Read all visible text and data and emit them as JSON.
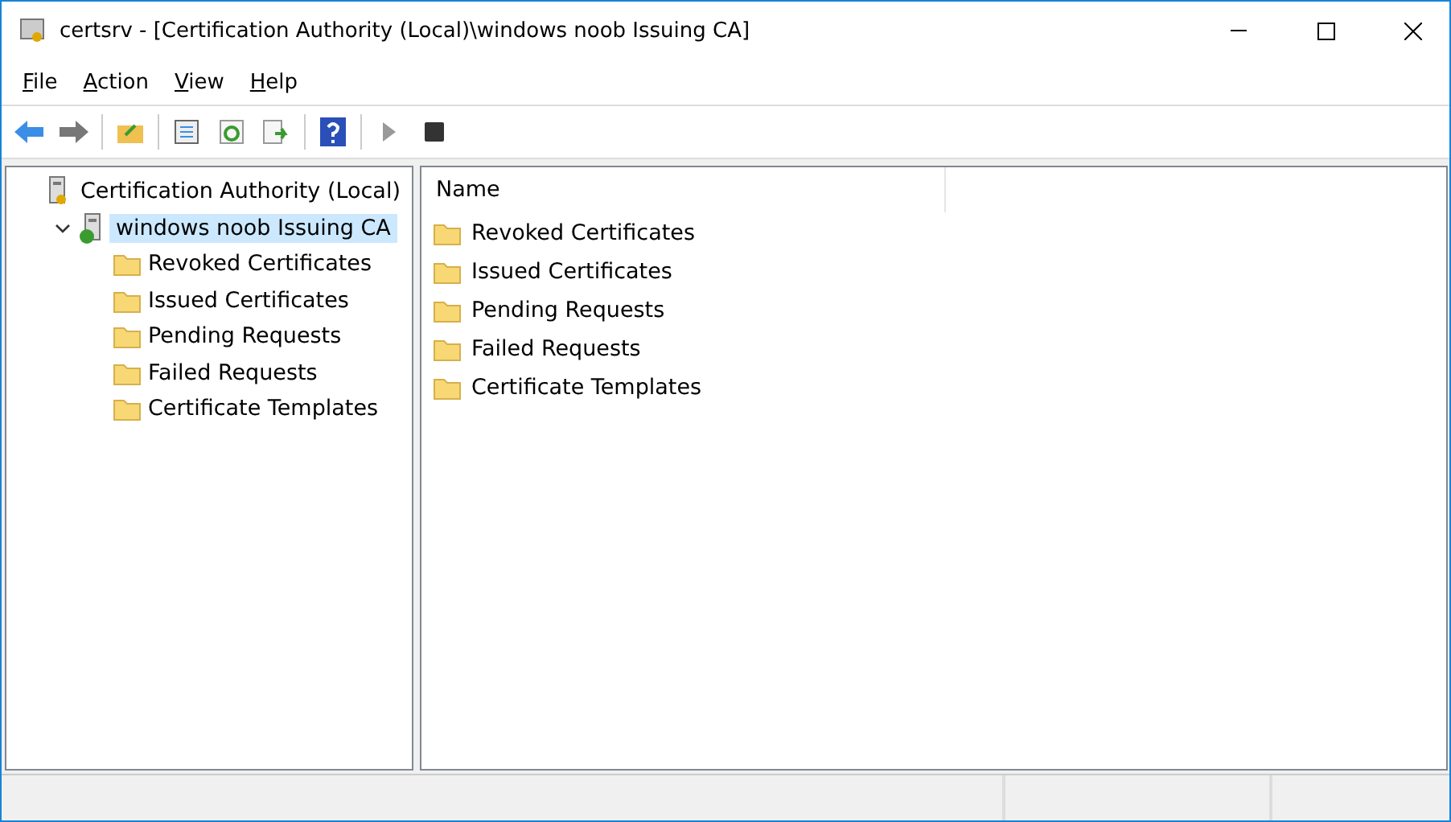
{
  "window": {
    "title": "certsrv - [Certification Authority (Local)\\windows noob Issuing CA]"
  },
  "menu": [
    {
      "label": "File"
    },
    {
      "label": "Action"
    },
    {
      "label": "View"
    },
    {
      "label": "Help"
    }
  ],
  "tree": [
    {
      "label": "Certification Authority (Local)",
      "kind": "server",
      "selected": false,
      "children": [
        {
          "label": "windows noob Issuing CA",
          "kind": "ca",
          "selected": true,
          "expanded": true,
          "children": [
            {
              "label": "Revoked Certificates",
              "kind": "folder",
              "selected": false
            },
            {
              "label": "Issued Certificates",
              "kind": "folder",
              "selected": false
            },
            {
              "label": "Pending Requests",
              "kind": "folder",
              "selected": false
            },
            {
              "label": "Failed Requests",
              "kind": "folder",
              "selected": false
            },
            {
              "label": "Certificate Templates",
              "kind": "folder",
              "selected": false
            }
          ]
        }
      ]
    }
  ],
  "list": {
    "columns": [
      "Name"
    ],
    "rows": [
      {
        "name": "Revoked Certificates"
      },
      {
        "name": "Issued Certificates"
      },
      {
        "name": "Pending Requests"
      },
      {
        "name": "Failed Requests"
      },
      {
        "name": "Certificate Templates"
      }
    ]
  }
}
